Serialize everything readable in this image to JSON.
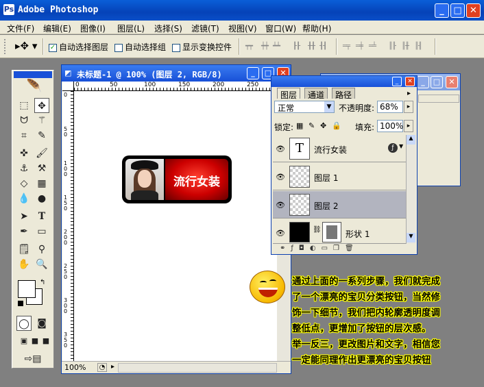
{
  "app": {
    "title": "Adobe Photoshop"
  },
  "menu": [
    "文件(F)",
    "编辑(E)",
    "图像(I)",
    "图层(L)",
    "选择(S)",
    "滤镜(T)",
    "视图(V)",
    "窗口(W)",
    "帮助(H)"
  ],
  "options": {
    "auto_select_layer": "自动选择图层",
    "auto_select_group": "自动选择组",
    "show_transform": "显示变换控件"
  },
  "document": {
    "title": "未标题-1 @ 100% (图层 2, RGB/8)",
    "zoom": "100%",
    "ruler_h": [
      "0",
      "50",
      "100",
      "150",
      "200",
      "250"
    ],
    "ruler_v": [
      "0",
      "5 0",
      "1 0 0",
      "1 5 0",
      "2 0 0",
      "2 5 0",
      "3 0 0",
      "3 5 0"
    ],
    "button_text": "流行女装"
  },
  "layers_panel": {
    "tabs": [
      "图层",
      "通道",
      "路径"
    ],
    "blend_mode": "正常",
    "opacity_label": "不透明度:",
    "opacity_value": "68%",
    "lock_label": "锁定:",
    "fill_label": "填充:",
    "fill_value": "100%",
    "layers": [
      {
        "name": "流行女装",
        "type": "text"
      },
      {
        "name": "图层 1",
        "type": "pixel"
      },
      {
        "name": "图层 2",
        "type": "pixel",
        "selected": true
      },
      {
        "name": "形状 1",
        "type": "shape"
      }
    ]
  },
  "note": [
    "通过上面的一系列步骤，我们就完成",
    "了一个漂亮的宝贝分类按钮，当然修",
    "饰一下细节，我们把内轮廓透明度调",
    "整低点，更增加了按钮的层次感。",
    "举一反三，更改图片和文字，相信您",
    "一定能同理作出更漂亮的宝贝按钮"
  ],
  "colors": {
    "titlebar": "#0542b8",
    "note_text_outline": "#ffff00",
    "button_red": "#cc0000"
  }
}
